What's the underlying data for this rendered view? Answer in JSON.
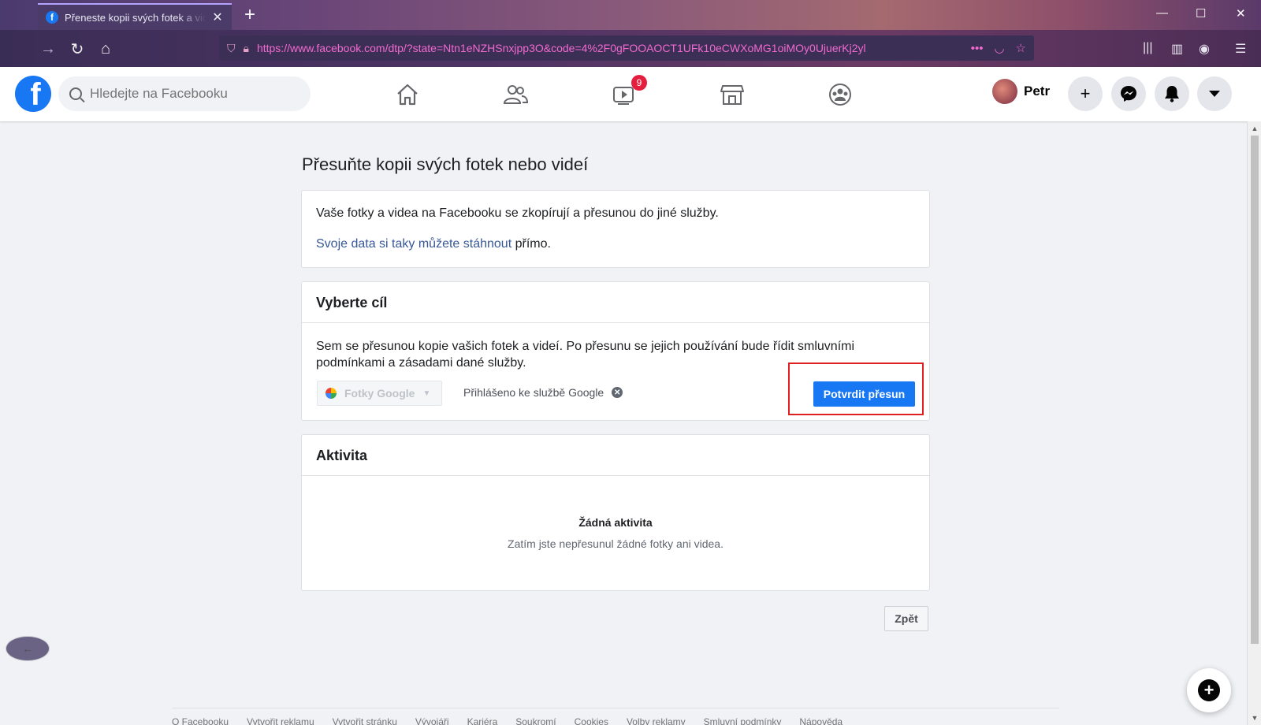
{
  "browser": {
    "tab_title": "Přeneste kopii svých fotek a videí",
    "url": "https://www.facebook.com/dtp/?state=Ntn1eNZHSnxjpp3O&code=4%2F0gFOOAOCT1UFk10eCWXoMG1oiMOy0UjuerKj2yl",
    "new_tab": "+",
    "tab_close": "✕",
    "more": "•••"
  },
  "fb": {
    "logo": "f",
    "search_placeholder": "Hledejte na Facebooku",
    "watch_badge": "9",
    "profile_name": "Petr"
  },
  "page": {
    "title": "Přesuňte kopii svých fotek nebo videí",
    "info_text": "Vaše fotky a videa na Facebooku se zkopírují a přesunou do jiné služby.",
    "download_link": "Svoje data si taky můžete stáhnout",
    "download_suffix": " přímo.",
    "destination_header": "Vyberte cíl",
    "destination_desc": "Sem se přesunou kopie vašich fotek a videí. Po přesunu se jejich používání bude řídit smluvními podmínkami a zásadami dané služby.",
    "service_selected": "Fotky Google",
    "signed_in": "Přihlášeno ke službě Google",
    "confirm_button": "Potvrdit přesun",
    "activity_header": "Aktivita",
    "empty_title": "Žádná aktivita",
    "empty_sub": "Zatím jste nepřesunul žádné fotky ani videa.",
    "back_button": "Zpět"
  },
  "footer": {
    "links": [
      "O Facebooku",
      "Vytvořit reklamu",
      "Vytvořit stránku",
      "Vývojáři",
      "Kariéra",
      "Soukromí",
      "Cookies",
      "Volby reklamy",
      "Smluvní podmínky",
      "Nápověda"
    ]
  },
  "colors": {
    "fb_blue": "#1877f2",
    "link": "#385898",
    "highlight_red": "#e02020",
    "badge_red": "#e41e3f"
  }
}
